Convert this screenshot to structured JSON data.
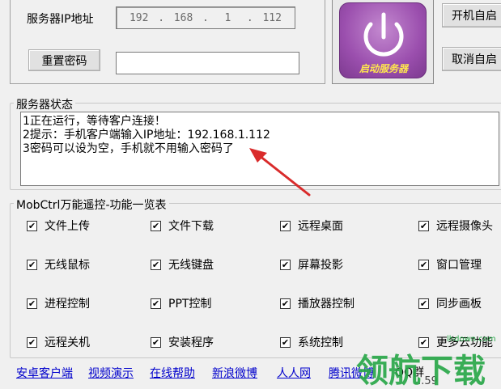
{
  "server": {
    "ip_label": "服务器IP地址",
    "ip_octets": [
      "192",
      "168",
      "1",
      "112"
    ],
    "ip_separator": ".",
    "reset_password_label": "重置密码",
    "password_value": "",
    "start_label": "启动服务器"
  },
  "autostart": {
    "enable_label": "开机自启",
    "disable_label": "取消自启"
  },
  "status": {
    "title": "服务器状态",
    "lines": [
      "1正在运行，等待客户连接！",
      "2提示：手机客户端输入IP地址：192.168.1.112",
      "3密码可以设为空，手机就不用输入密码了"
    ]
  },
  "features": {
    "title": "MobCtrl万能遥控-功能一览表",
    "check_mark": "✔",
    "items": [
      [
        "文件上传",
        "文件下载",
        "远程桌面",
        "远程摄像头"
      ],
      [
        "无线鼠标",
        "无线键盘",
        "屏幕投影",
        "窗口管理"
      ],
      [
        "进程控制",
        "PPT控制",
        "播放器控制",
        "同步画板"
      ],
      [
        "远程关机",
        "安装程序",
        "系统控制",
        "更多云功能"
      ]
    ]
  },
  "links": [
    "安卓客户端",
    "视频演示",
    "在线帮助",
    "新浪微博",
    "人人网",
    "腾讯微博"
  ],
  "qq": {
    "label": "QQ群",
    "value": "...59"
  },
  "watermark": {
    "text": "领航下载",
    "site": "lhdown.com"
  },
  "colors": {
    "link": "#0000cc",
    "arrow": "#d92b2b",
    "watermark": "#2aa84a",
    "power_button": "#9b4fae"
  }
}
